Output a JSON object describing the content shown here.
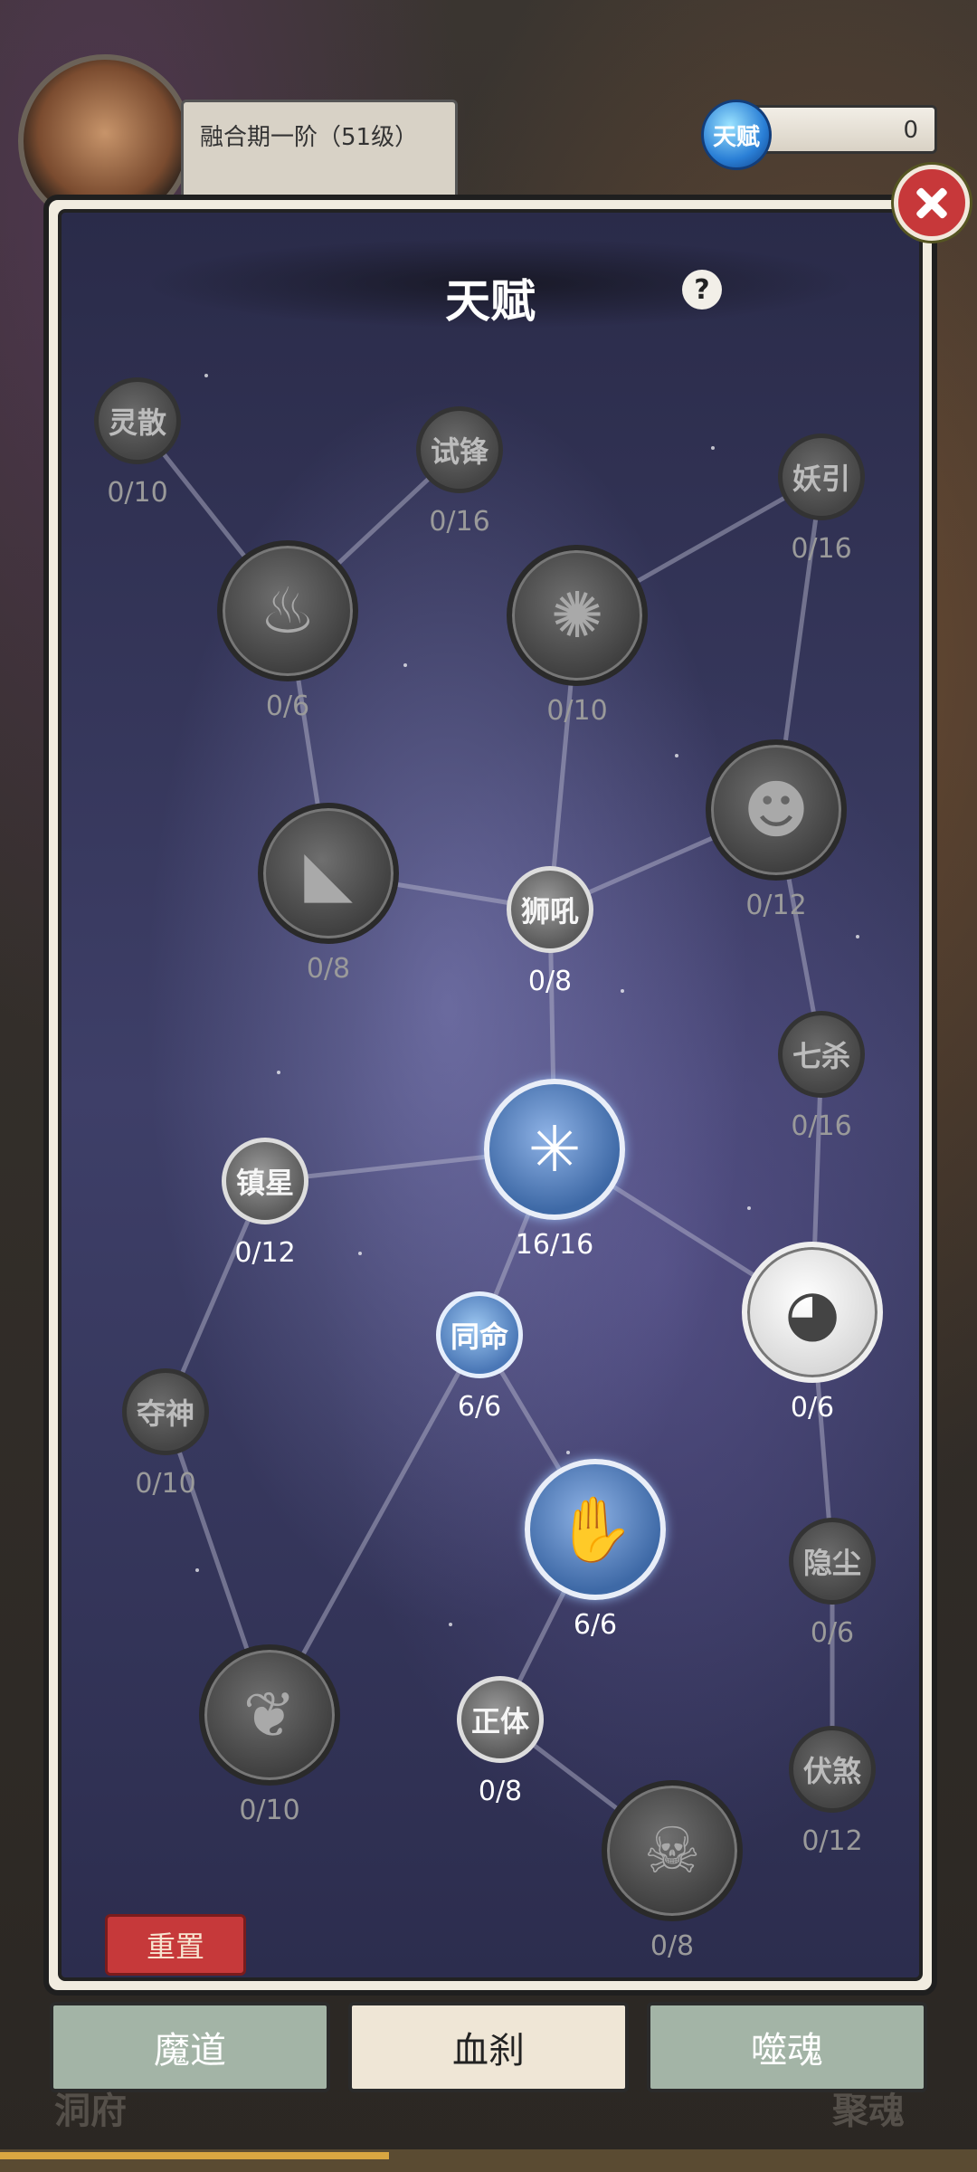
{
  "header": {
    "level_text": "融合期一阶（51级）",
    "currency_icon_label": "天赋",
    "currency_value": "0"
  },
  "modal": {
    "title": "天赋",
    "help_label": "?",
    "reset_label": "重置",
    "nodes": {
      "lingsan": {
        "label": "灵散",
        "count": "0/10"
      },
      "shifeng": {
        "label": "试锋",
        "count": "0/16"
      },
      "yaoyin": {
        "label": "妖引",
        "count": "0/16"
      },
      "flame": {
        "icon": "flame-icon",
        "count": "0/6"
      },
      "burst": {
        "icon": "burst-icon",
        "count": "0/10"
      },
      "grin": {
        "icon": "grin-face-icon",
        "count": "0/12"
      },
      "fang": {
        "icon": "fang-icon",
        "count": "0/8"
      },
      "shihou": {
        "label": "狮吼",
        "count": "0/8"
      },
      "qisha": {
        "label": "七杀",
        "count": "0/16"
      },
      "spider": {
        "icon": "spider-icon",
        "count": "16/16"
      },
      "zhenxing": {
        "label": "镇星",
        "count": "0/12"
      },
      "tongming": {
        "label": "同命",
        "count": "6/6"
      },
      "moon": {
        "icon": "moon-icon",
        "count": "0/6"
      },
      "duoshen": {
        "label": "夺神",
        "count": "0/10"
      },
      "hand": {
        "icon": "grave-hand-icon",
        "count": "6/6"
      },
      "yinchen": {
        "label": "隐尘",
        "count": "0/6"
      },
      "shell": {
        "icon": "shell-icon",
        "count": "0/10"
      },
      "zhengti": {
        "label": "正体",
        "count": "0/8"
      },
      "fuzha": {
        "label": "伏煞",
        "count": "0/12"
      },
      "skull": {
        "icon": "skull-icon",
        "count": "0/8"
      }
    }
  },
  "tabs": [
    {
      "label": "魔道"
    },
    {
      "label": "血刹"
    },
    {
      "label": "噬魂"
    }
  ],
  "bottom_labels": {
    "left": "洞府",
    "right": "聚魂"
  }
}
